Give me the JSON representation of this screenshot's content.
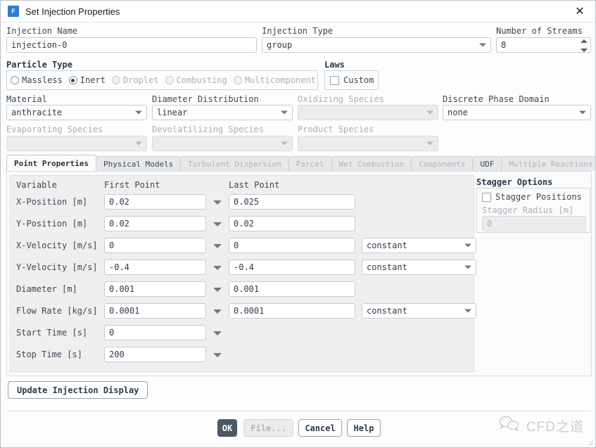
{
  "titlebar": {
    "icon": "fluent-app-icon",
    "icon_letter": "F",
    "title": "Set Injection Properties",
    "close": "✕"
  },
  "top": {
    "injection_name_label": "Injection Name",
    "injection_name_value": "injection-0",
    "injection_type_label": "Injection Type",
    "injection_type_value": "group",
    "streams_label": "Number of Streams",
    "streams_value": "8"
  },
  "particle_type": {
    "group_label": "Particle Type",
    "options": [
      {
        "label": "Massless",
        "selected": false,
        "disabled": false
      },
      {
        "label": "Inert",
        "selected": true,
        "disabled": false
      },
      {
        "label": "Droplet",
        "selected": false,
        "disabled": true
      },
      {
        "label": "Combusting",
        "selected": false,
        "disabled": true
      },
      {
        "label": "Multicomponent",
        "selected": false,
        "disabled": true
      }
    ]
  },
  "laws": {
    "group_label": "Laws",
    "custom_label": "Custom",
    "custom_checked": false
  },
  "selectors": {
    "material_label": "Material",
    "material_value": "anthracite",
    "diameter_distribution_label": "Diameter Distribution",
    "diameter_distribution_value": "linear",
    "oxidizing_species_label": "Oxidizing Species",
    "oxidizing_species_value": "",
    "discrete_phase_domain_label": "Discrete Phase Domain",
    "discrete_phase_domain_value": "none",
    "evaporating_species_label": "Evaporating Species",
    "evaporating_species_value": "",
    "devolatilizing_species_label": "Devolatilizing Species",
    "devolatilizing_species_value": "",
    "product_species_label": "Product Species",
    "product_species_value": ""
  },
  "tabs": [
    {
      "label": "Point Properties",
      "active": true,
      "disabled": false
    },
    {
      "label": "Physical Models",
      "active": false,
      "disabled": false
    },
    {
      "label": "Turbulent Dispersion",
      "active": false,
      "disabled": true
    },
    {
      "label": "Parcel",
      "active": false,
      "disabled": true
    },
    {
      "label": "Wet Combustion",
      "active": false,
      "disabled": true
    },
    {
      "label": "Components",
      "active": false,
      "disabled": true
    },
    {
      "label": "UDF",
      "active": false,
      "disabled": false
    },
    {
      "label": "Multiple Reactions",
      "active": false,
      "disabled": true
    }
  ],
  "point_properties": {
    "headers": {
      "variable": "Variable",
      "first_point": "First Point",
      "last_point": "Last Point"
    },
    "rows": [
      {
        "variable": "X-Position [m]",
        "first": "0.02",
        "last": "0.025",
        "law": null
      },
      {
        "variable": "Y-Position [m]",
        "first": "0.02",
        "last": "0.02",
        "law": null
      },
      {
        "variable": "X-Velocity [m/s]",
        "first": "0",
        "last": "0",
        "law": "constant"
      },
      {
        "variable": "Y-Velocity [m/s]",
        "first": "-0.4",
        "last": "-0.4",
        "law": "constant"
      },
      {
        "variable": "Diameter [m]",
        "first": "0.001",
        "last": "0.001",
        "law": null
      },
      {
        "variable": "Flow Rate [kg/s]",
        "first": "0.0001",
        "last": "0.0001",
        "law": "constant"
      },
      {
        "variable": "Start Time [s]",
        "first": "0",
        "last": null,
        "law": null
      },
      {
        "variable": "Stop Time [s]",
        "first": "200",
        "last": null,
        "law": null
      }
    ]
  },
  "stagger": {
    "group_label": "Stagger Options",
    "positions_label": "Stagger Positions",
    "positions_checked": false,
    "radius_label": "Stagger Radius [m]",
    "radius_value": "0"
  },
  "actions": {
    "update_label": "Update Injection Display",
    "ok_label": "OK",
    "file_label": "File...",
    "cancel_label": "Cancel",
    "help_label": "Help"
  },
  "watermark": {
    "text": "CFD之道",
    "logo": "wechat-icon"
  },
  "colors": {
    "accent": "#4a5868",
    "app_icon": "#2b7cd3",
    "panel_bg": "#efeff0",
    "disabled_text": "#a9b0b8"
  }
}
